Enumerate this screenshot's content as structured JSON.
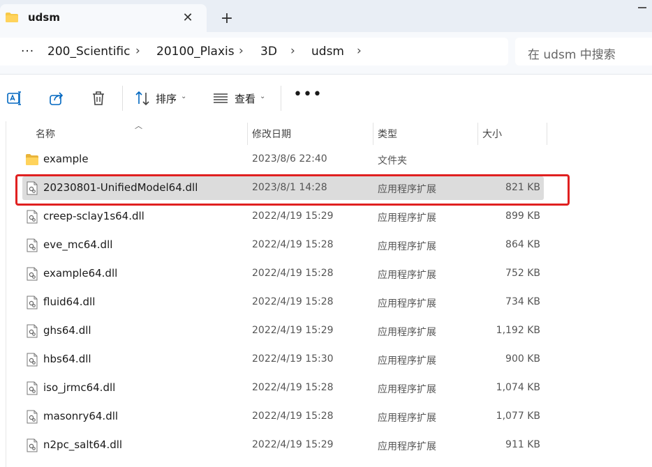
{
  "tab": {
    "title": "udsm",
    "close_glyph": "✕",
    "new_glyph": "+"
  },
  "address": {
    "overflow": "···",
    "crumbs": [
      "200_Scientific",
      "20100_Plaxis",
      "3D",
      "udsm"
    ],
    "separator": "›"
  },
  "search": {
    "placeholder": "在 udsm 中搜索"
  },
  "toolbar": {
    "sort_label": "排序",
    "view_label": "查看",
    "more": "•••",
    "caret": "⌄"
  },
  "columns": {
    "name": "名称",
    "date": "修改日期",
    "type": "类型",
    "size": "大小"
  },
  "files": [
    {
      "name": "example",
      "date": "2023/8/6 22:40",
      "type": "文件夹",
      "size": "",
      "kind": "folder"
    },
    {
      "name": "20230801-UnifiedModel64.dll",
      "date": "2023/8/1 14:28",
      "type": "应用程序扩展",
      "size": "821 KB",
      "kind": "dll",
      "selected": true
    },
    {
      "name": "creep-sclay1s64.dll",
      "date": "2022/4/19 15:29",
      "type": "应用程序扩展",
      "size": "899 KB",
      "kind": "dll"
    },
    {
      "name": "eve_mc64.dll",
      "date": "2022/4/19 15:28",
      "type": "应用程序扩展",
      "size": "864 KB",
      "kind": "dll"
    },
    {
      "name": "example64.dll",
      "date": "2022/4/19 15:28",
      "type": "应用程序扩展",
      "size": "752 KB",
      "kind": "dll"
    },
    {
      "name": "fluid64.dll",
      "date": "2022/4/19 15:28",
      "type": "应用程序扩展",
      "size": "734 KB",
      "kind": "dll"
    },
    {
      "name": "ghs64.dll",
      "date": "2022/4/19 15:29",
      "type": "应用程序扩展",
      "size": "1,192 KB",
      "kind": "dll"
    },
    {
      "name": "hbs64.dll",
      "date": "2022/4/19 15:30",
      "type": "应用程序扩展",
      "size": "900 KB",
      "kind": "dll"
    },
    {
      "name": "iso_jrmc64.dll",
      "date": "2022/4/19 15:28",
      "type": "应用程序扩展",
      "size": "1,074 KB",
      "kind": "dll"
    },
    {
      "name": "masonry64.dll",
      "date": "2022/4/19 15:28",
      "type": "应用程序扩展",
      "size": "1,077 KB",
      "kind": "dll"
    },
    {
      "name": "n2pc_salt64.dll",
      "date": "2022/4/19 15:29",
      "type": "应用程序扩展",
      "size": "911 KB",
      "kind": "dll"
    }
  ],
  "colors": {
    "accent": "#0067c0",
    "highlight": "#e02020",
    "folder": "#f7c948",
    "selected_row": "#dcdcdc"
  }
}
